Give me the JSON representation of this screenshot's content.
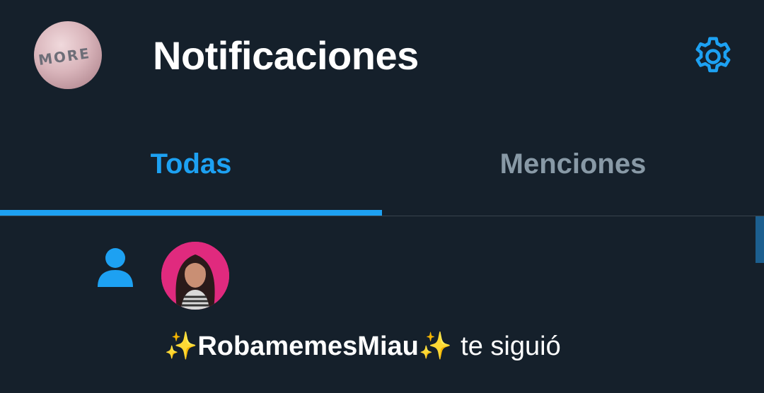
{
  "header": {
    "title": "Notificaciones",
    "avatar_shirt_text": "MORE",
    "settings_icon": "gear-icon"
  },
  "tabs": [
    {
      "label": "Todas",
      "selected": true
    },
    {
      "label": "Menciones",
      "selected": false
    }
  ],
  "notifications": [
    {
      "type": "follow",
      "icon": "person-icon",
      "username": "✨RobamemesMiau✨",
      "action": "te siguió"
    }
  ],
  "colors": {
    "background": "#15202b",
    "accent": "#1da1f2",
    "muted_text": "#8899a6",
    "divider": "#38444d"
  }
}
